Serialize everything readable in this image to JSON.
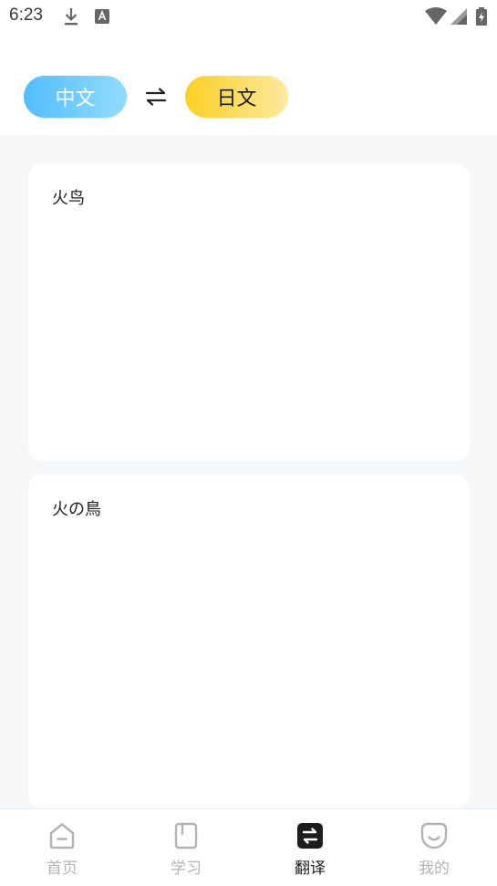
{
  "status_bar": {
    "time": "6:23",
    "icons": [
      "download-icon",
      "a-notification-icon",
      "wifi-icon",
      "signal-icon",
      "battery-charging-icon"
    ]
  },
  "language_selector": {
    "source": "中文",
    "target": "日文",
    "swap_icon": "swap-arrows-icon",
    "source_gradient": [
      "#52bdfb",
      "#92dcfd"
    ],
    "target_gradient": [
      "#fbd023",
      "#fde9a0"
    ]
  },
  "input_card": {
    "text": "火鸟"
  },
  "output_card": {
    "text": "火の鳥"
  },
  "bottom_nav": {
    "active_index": 2,
    "items": [
      {
        "label": "首页",
        "icon": "home-icon"
      },
      {
        "label": "学习",
        "icon": "book-icon"
      },
      {
        "label": "翻译",
        "icon": "translate-icon"
      },
      {
        "label": "我的",
        "icon": "profile-smile-icon"
      }
    ]
  },
  "colors": {
    "background": "#f6f7f9",
    "card": "#ffffff",
    "nav_inactive": "#b3b3b3",
    "nav_active": "#1d1d1d"
  }
}
